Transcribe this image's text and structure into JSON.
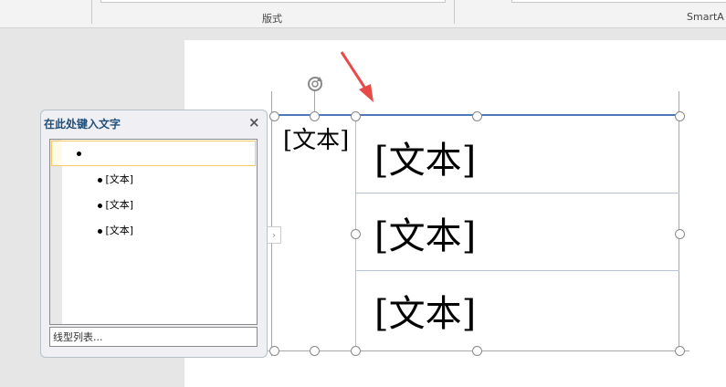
{
  "ribbon": {
    "group_layout": "版式",
    "group_smartart": "SmartA"
  },
  "slide": {
    "left_label": "[文本]",
    "rows": [
      "[文本]",
      "[文本]",
      "[文本]"
    ]
  },
  "text_pane": {
    "title": "在此处键入文字",
    "close": "×",
    "items": [
      "[文本]",
      "[文本]",
      "[文本]"
    ],
    "footer": "线型列表..."
  },
  "colors": {
    "accent_line": "#4a78b8",
    "arrow": "#e84a4a"
  }
}
